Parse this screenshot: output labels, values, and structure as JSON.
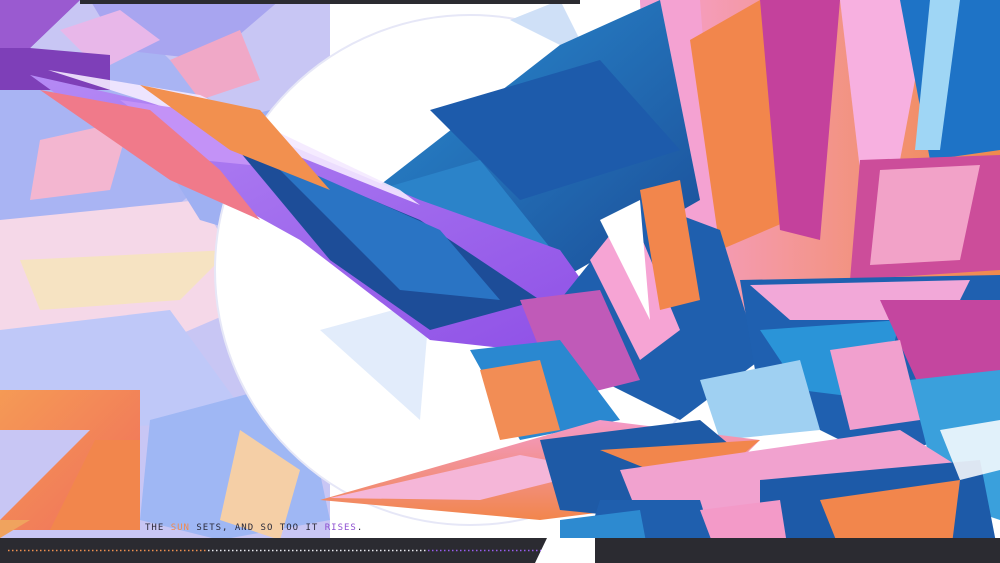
{
  "tagline": {
    "part1": "The ",
    "word_sun": "sun",
    "part2": " sets, and so too it ",
    "word_rises": "rises",
    "part3": "."
  },
  "colors": {
    "deep_blue": "#1e5aa6",
    "light_blue": "#7fb6e6",
    "pale_lavender": "#c9c8f2",
    "violet": "#9a5cf0",
    "pink": "#f39ac8",
    "coral": "#f07a5a",
    "orange": "#f2904f",
    "bar": "#2b2b31"
  }
}
